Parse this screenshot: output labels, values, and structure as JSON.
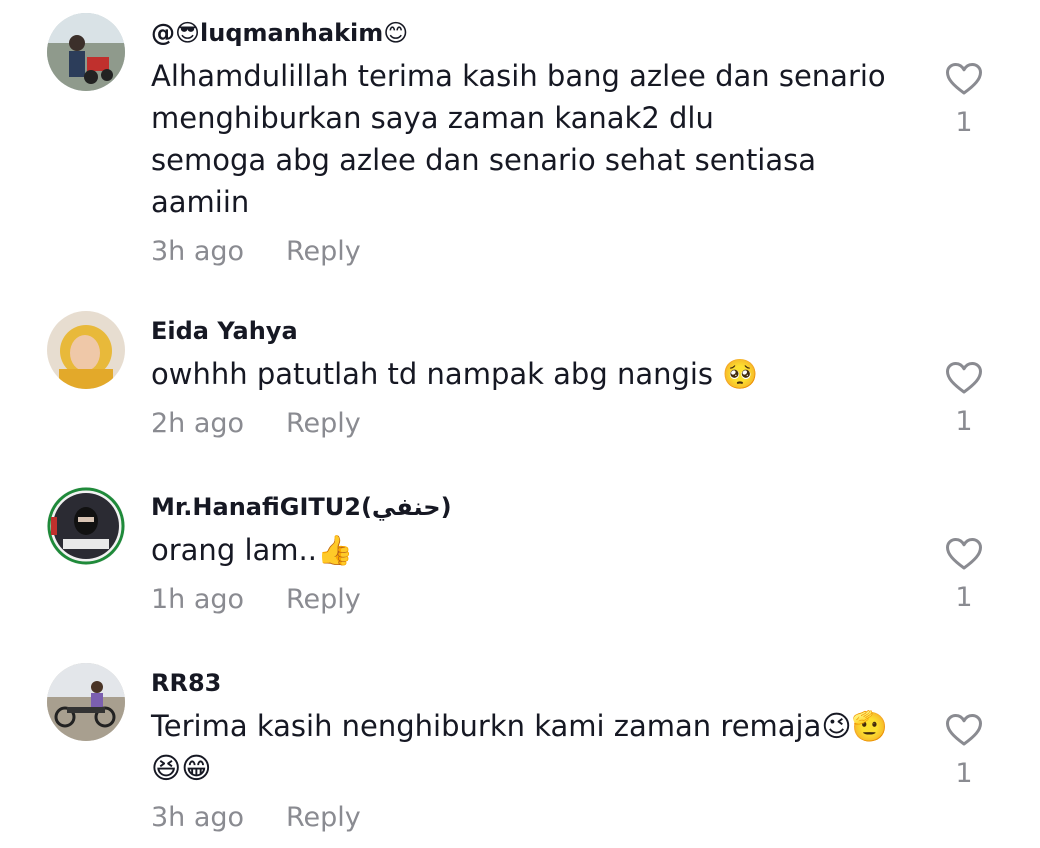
{
  "comments": [
    {
      "username": "@😎luqmanhakim😊",
      "lines": [
        "Alhamdulillah terima kasih bang azlee dan senario",
        "menghiburkan saya zaman kanak2 dlu",
        "semoga abg azlee dan senario sehat sentiasa",
        "aamiin"
      ],
      "time": "3h ago",
      "reply_label": "Reply",
      "like_count": "1"
    },
    {
      "username": "Eida Yahya",
      "lines": [
        "owhhh patutlah td nampak abg nangis 🥺"
      ],
      "time": "2h ago",
      "reply_label": "Reply",
      "like_count": "1"
    },
    {
      "username": "Mr.HanafiGITU2(حنفي)",
      "lines": [
        "orang lam..👍"
      ],
      "time": "1h ago",
      "reply_label": "Reply",
      "like_count": "1"
    },
    {
      "username": "RR83",
      "lines": [
        "Terima kasih nenghiburkn kami zaman remaja😉🫡",
        "😆😁"
      ],
      "time": "3h ago",
      "reply_label": "Reply",
      "like_count": "1"
    }
  ],
  "icons": {
    "like": "heart-outline-icon"
  },
  "colors": {
    "text": "#161823",
    "secondary": "#8a8b91",
    "background": "#ffffff"
  }
}
